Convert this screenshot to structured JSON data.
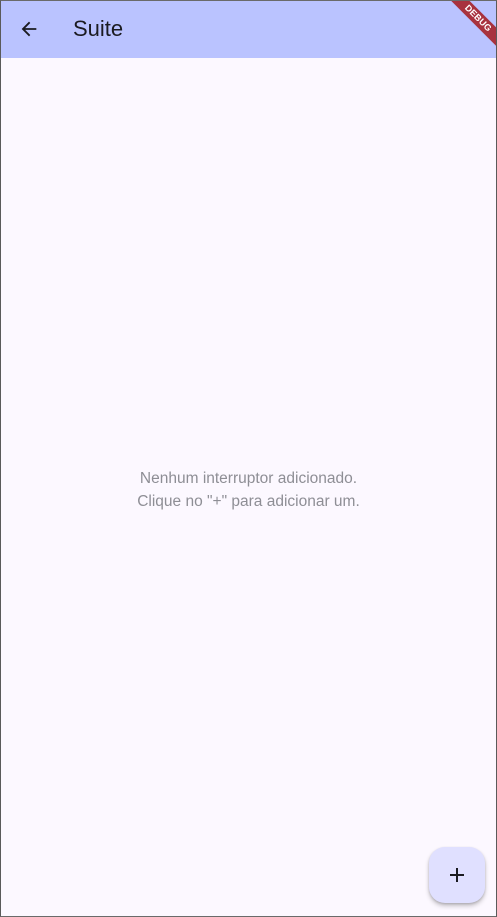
{
  "app_bar": {
    "title": "Suite",
    "back_icon": "arrow-back-icon",
    "background": "#bac3ff"
  },
  "debug_banner": {
    "label": "DEBUG",
    "color": "#a8323e"
  },
  "empty_state": {
    "line1": "Nenhum interruptor adicionado.",
    "line2": "Clique no \"+\" para adicionar um."
  },
  "fab": {
    "icon": "add-icon",
    "background": "#e0e0ff"
  },
  "colors": {
    "page_background": "#fcf8ff",
    "text_primary": "#1b1b21",
    "text_muted": "#8e8e95"
  }
}
